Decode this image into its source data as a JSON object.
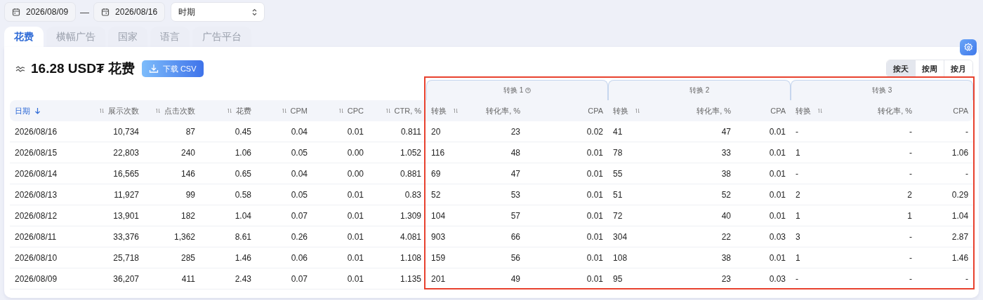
{
  "date_range": {
    "start": "2026/08/09",
    "separator": "—",
    "end": "2026/08/16"
  },
  "period_select": {
    "value": "时期"
  },
  "tabs": [
    {
      "label": "花费",
      "selected": true
    },
    {
      "label": "横幅广告",
      "selected": false
    },
    {
      "label": "国家",
      "selected": false
    },
    {
      "label": "语言",
      "selected": false
    },
    {
      "label": "广告平台",
      "selected": false
    }
  ],
  "summary": {
    "title": "16.28 USD₮ 花费",
    "download_button": "下载 CSV"
  },
  "granularity": [
    {
      "label": "按天",
      "selected": true
    },
    {
      "label": "按周",
      "selected": false
    },
    {
      "label": "按月",
      "selected": false
    }
  ],
  "table": {
    "groups": [
      {
        "label": "转换 1",
        "help": true
      },
      {
        "label": "转换 2",
        "help": false
      },
      {
        "label": "转换 3",
        "help": false
      }
    ],
    "columns": [
      {
        "label": "日期",
        "kind": "key",
        "sortable": true,
        "selected": true
      },
      {
        "label": "展示次数",
        "kind": "metric",
        "sortable": true,
        "selected": false
      },
      {
        "label": "点击次数",
        "kind": "metric",
        "sortable": true,
        "selected": false
      },
      {
        "label": "花费",
        "kind": "metric",
        "sortable": true,
        "selected": false
      },
      {
        "label": "CPM",
        "kind": "metric",
        "sortable": true,
        "selected": false
      },
      {
        "label": "CPC",
        "kind": "metric",
        "sortable": true,
        "selected": false
      },
      {
        "label": "CTR, %",
        "kind": "metric",
        "sortable": true,
        "selected": false
      },
      {
        "label": "转换",
        "kind": "count",
        "sortable": true,
        "selected": false
      },
      {
        "label": "转化率, %",
        "kind": "metric",
        "sortable": false,
        "selected": false
      },
      {
        "label": "CPA",
        "kind": "metric",
        "sortable": false,
        "selected": false
      },
      {
        "label": "转换",
        "kind": "count",
        "sortable": true,
        "selected": false
      },
      {
        "label": "转化率, %",
        "kind": "metric",
        "sortable": false,
        "selected": false
      },
      {
        "label": "CPA",
        "kind": "metric",
        "sortable": false,
        "selected": false
      },
      {
        "label": "转换",
        "kind": "count",
        "sortable": true,
        "selected": false
      },
      {
        "label": "转化率, %",
        "kind": "metric",
        "sortable": false,
        "selected": false
      },
      {
        "label": "CPA",
        "kind": "metric",
        "sortable": false,
        "selected": false
      }
    ],
    "rows": [
      [
        "2026/08/16",
        "10,734",
        "87",
        "0.45",
        "0.04",
        "0.01",
        "0.811",
        "20",
        "23",
        "0.02",
        "41",
        "47",
        "0.01",
        "-",
        "-",
        "-"
      ],
      [
        "2026/08/15",
        "22,803",
        "240",
        "1.06",
        "0.05",
        "0.00",
        "1.052",
        "116",
        "48",
        "0.01",
        "78",
        "33",
        "0.01",
        "1",
        "-",
        "1.06"
      ],
      [
        "2026/08/14",
        "16,565",
        "146",
        "0.65",
        "0.04",
        "0.00",
        "0.881",
        "69",
        "47",
        "0.01",
        "55",
        "38",
        "0.01",
        "-",
        "-",
        "-"
      ],
      [
        "2026/08/13",
        "11,927",
        "99",
        "0.58",
        "0.05",
        "0.01",
        "0.83",
        "52",
        "53",
        "0.01",
        "51",
        "52",
        "0.01",
        "2",
        "2",
        "0.29"
      ],
      [
        "2026/08/12",
        "13,901",
        "182",
        "1.04",
        "0.07",
        "0.01",
        "1.309",
        "104",
        "57",
        "0.01",
        "72",
        "40",
        "0.01",
        "1",
        "1",
        "1.04"
      ],
      [
        "2026/08/11",
        "33,376",
        "1,362",
        "8.61",
        "0.26",
        "0.01",
        "4.081",
        "903",
        "66",
        "0.01",
        "304",
        "22",
        "0.03",
        "3",
        "-",
        "2.87"
      ],
      [
        "2026/08/10",
        "25,718",
        "285",
        "1.46",
        "0.06",
        "0.01",
        "1.108",
        "159",
        "56",
        "0.01",
        "108",
        "38",
        "0.01",
        "1",
        "-",
        "1.46"
      ],
      [
        "2026/08/09",
        "36,207",
        "411",
        "2.43",
        "0.07",
        "0.01",
        "1.135",
        "201",
        "49",
        "0.01",
        "95",
        "23",
        "0.03",
        "-",
        "-",
        "-"
      ]
    ]
  }
}
